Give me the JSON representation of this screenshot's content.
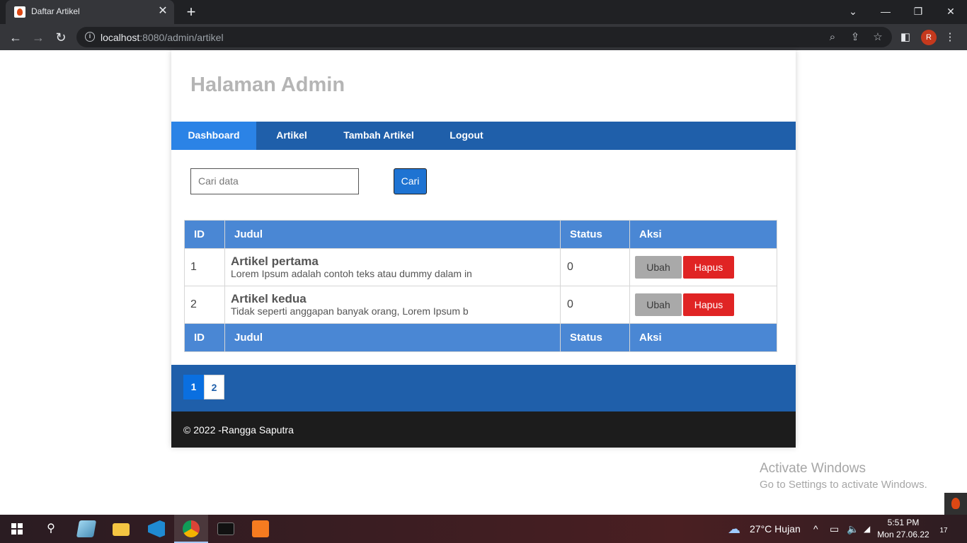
{
  "browser": {
    "tab_title": "Daftar Artikel",
    "url_host": "localhost",
    "url_rest": ":8080/admin/artikel",
    "profile_initial": "R"
  },
  "page": {
    "site_title": "Halaman Admin",
    "nav": [
      {
        "label": "Dashboard",
        "active": true
      },
      {
        "label": "Artikel"
      },
      {
        "label": "Tambah Artikel"
      },
      {
        "label": "Logout"
      }
    ],
    "search": {
      "placeholder": "Cari data",
      "button_label": "Cari"
    },
    "table": {
      "headers": [
        "ID",
        "Judul",
        "Status",
        "Aksi"
      ],
      "rows": [
        {
          "id": "1",
          "title": "Artikel pertama",
          "snippet": "Lorem Ipsum adalah contoh teks atau dummy dalam in",
          "status": "0",
          "edit_label": "Ubah",
          "delete_label": "Hapus"
        },
        {
          "id": "2",
          "title": "Artikel kedua",
          "snippet": "Tidak seperti anggapan banyak orang, Lorem Ipsum b",
          "status": "0",
          "edit_label": "Ubah",
          "delete_label": "Hapus"
        }
      ]
    },
    "pagination": [
      "1",
      "2"
    ],
    "footer_text": "© 2022 -Rangga Saputra"
  },
  "watermark": {
    "title": "Activate Windows",
    "subtitle": "Go to Settings to activate Windows."
  },
  "taskbar": {
    "weather": "27°C  Hujan",
    "time": "5:51 PM",
    "date": "Mon 27.06.22",
    "notification_count": "17"
  },
  "colors": {
    "nav_bar": "#1f5faa",
    "nav_active": "#2b83e6",
    "table_header": "#4a87d4",
    "delete_button": "#e02424",
    "footer": "#1c1c1c"
  }
}
